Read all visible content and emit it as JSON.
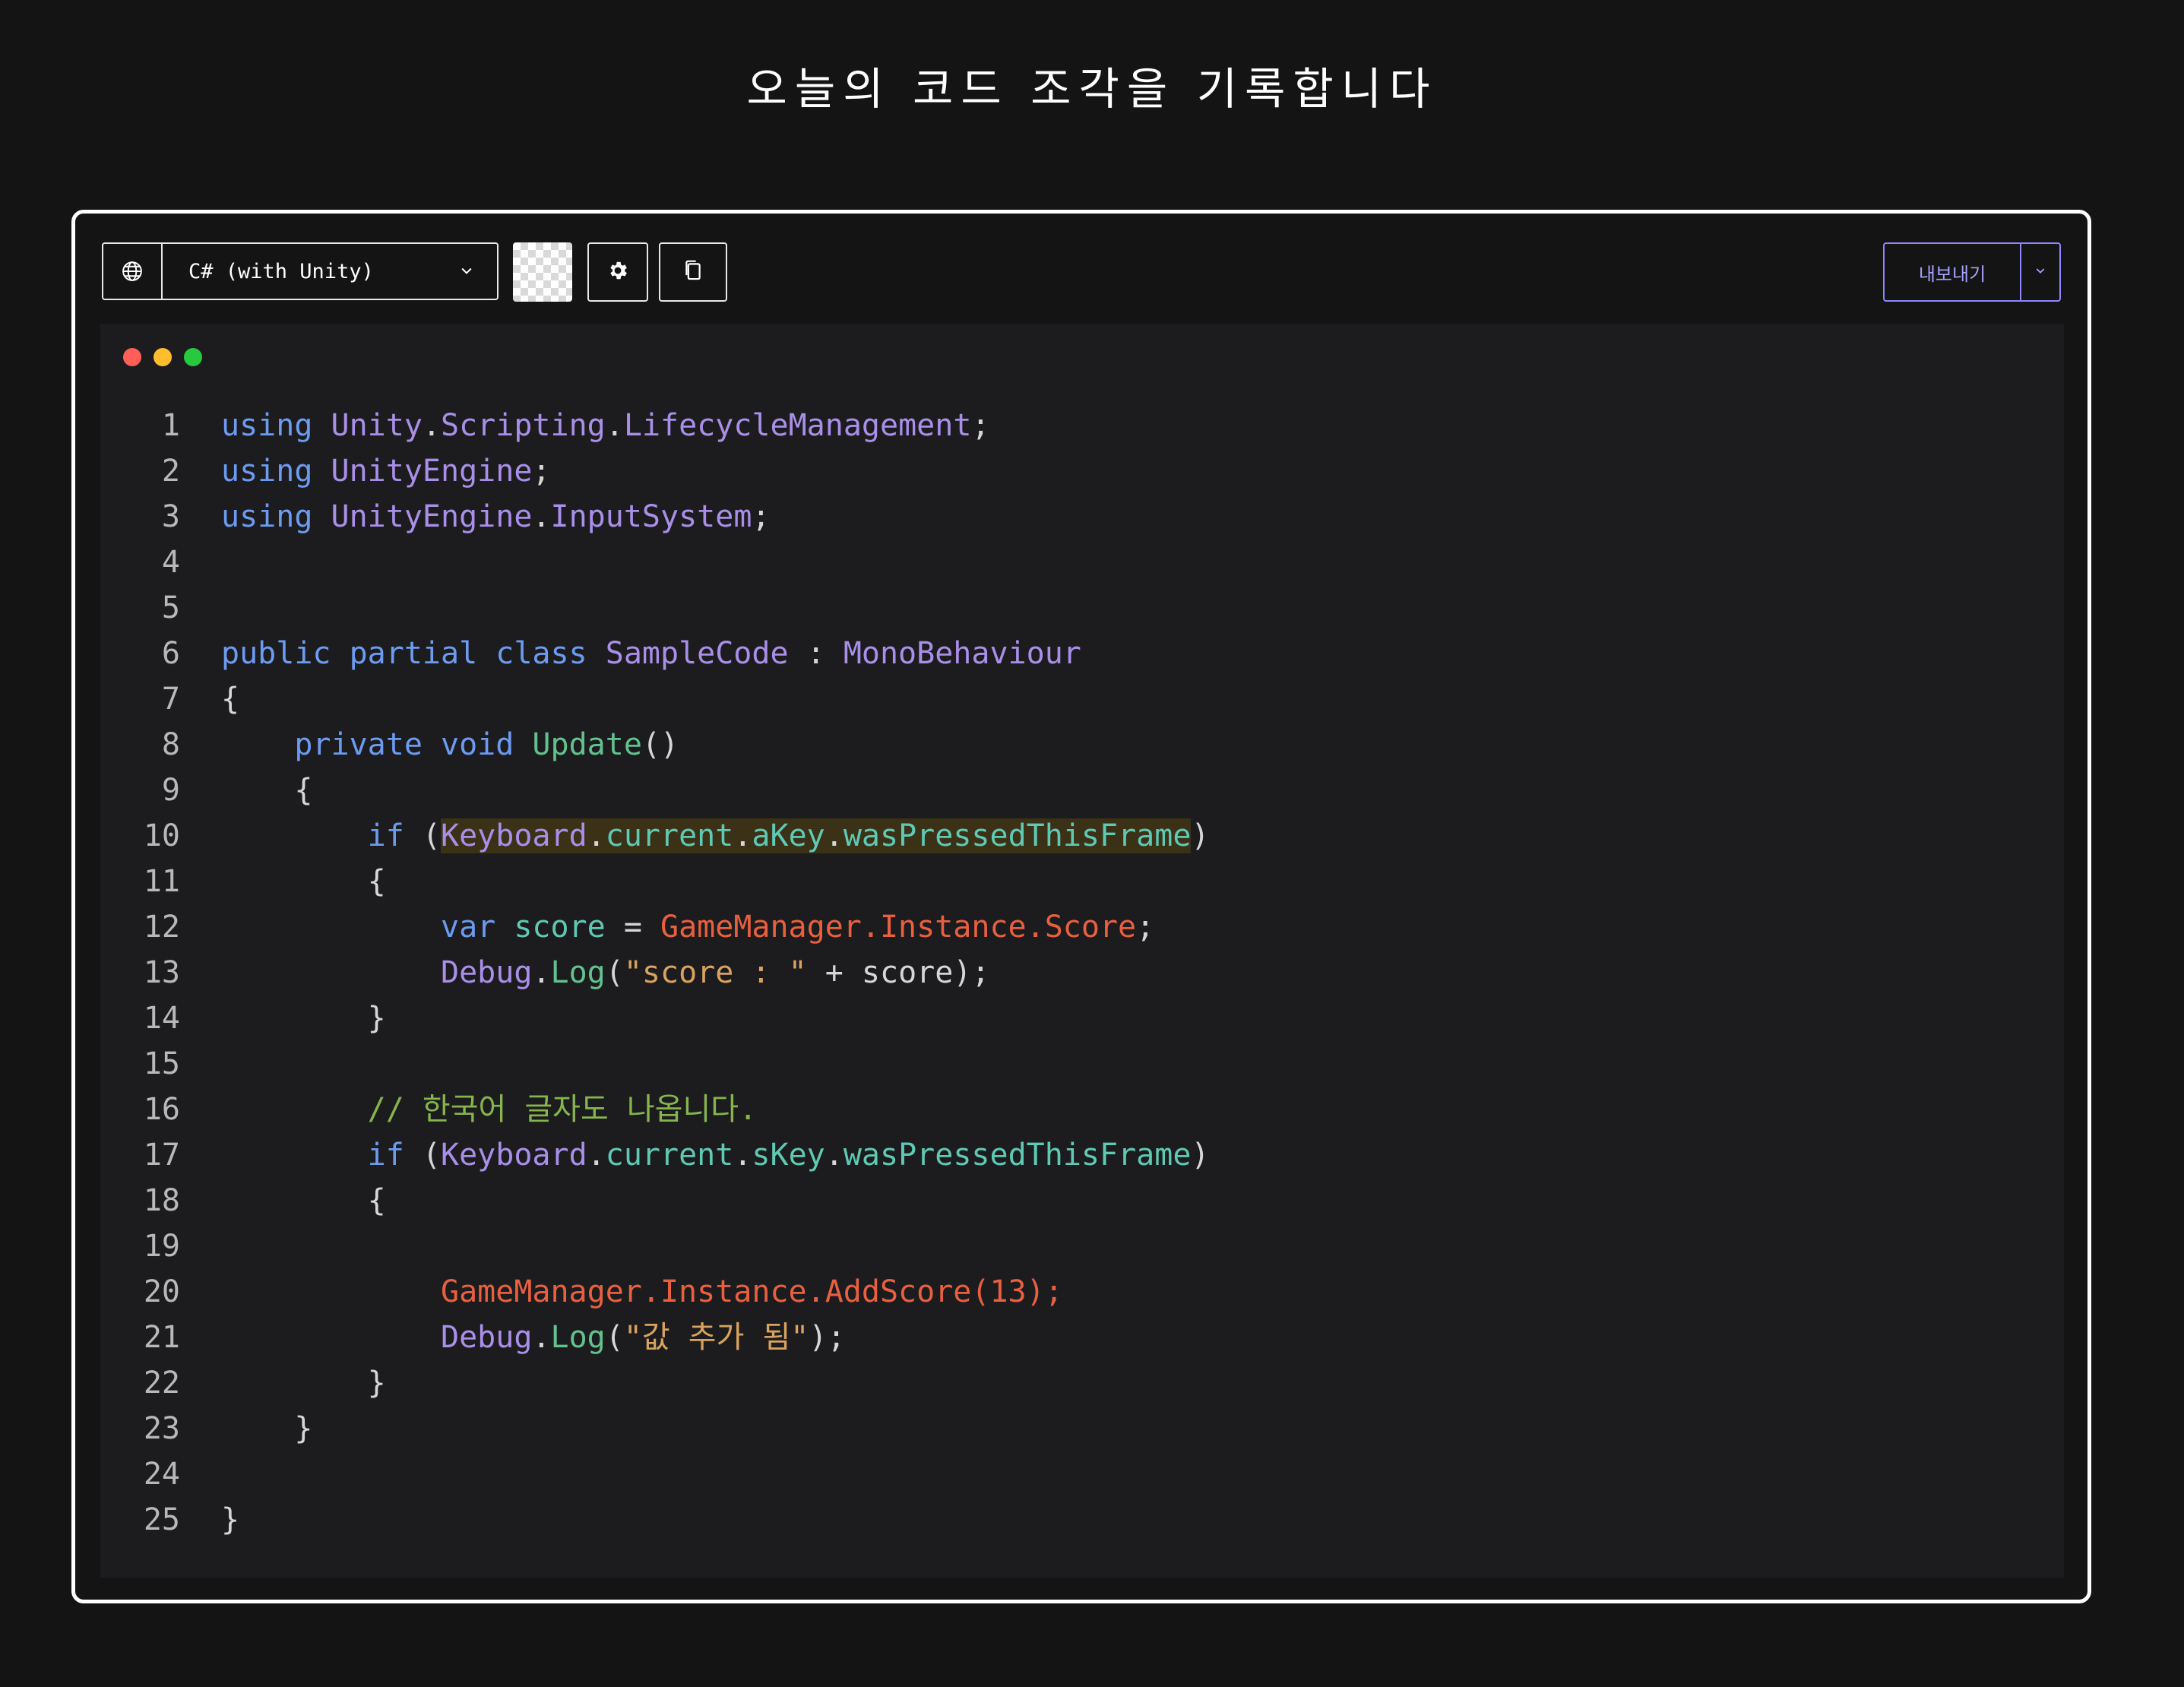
{
  "page": {
    "title": "오늘의 코드 조각을 기록합니다"
  },
  "toolbar": {
    "language": "C# (with Unity)",
    "export_label": "내보내기",
    "icons": [
      "globe-icon",
      "chevron-down-icon",
      "gear-icon",
      "copy-icon"
    ]
  },
  "window_dots": [
    "#ff5f56",
    "#ffbd2e",
    "#27c93f"
  ],
  "colors": {
    "keyword": "#6c9bf0",
    "type": "#a98fe8",
    "member": "#5fc9b4",
    "method": "#62c28f",
    "string": "#d9a35f",
    "gamemanager": "#e9603f",
    "comment": "#86b54d",
    "highlight": "#3a3117",
    "accent": "#8f86ff"
  },
  "code": {
    "lines": [
      {
        "n": "1",
        "tokens": [
          [
            "kw",
            "using "
          ],
          [
            "ty",
            "Unity"
          ],
          [
            "pn",
            "."
          ],
          [
            "ty",
            "Scripting"
          ],
          [
            "pn",
            "."
          ],
          [
            "ty",
            "LifecycleManagement"
          ],
          [
            "pn",
            ";"
          ]
        ]
      },
      {
        "n": "2",
        "tokens": [
          [
            "kw",
            "using "
          ],
          [
            "ty",
            "UnityEngine"
          ],
          [
            "pn",
            ";"
          ]
        ]
      },
      {
        "n": "3",
        "tokens": [
          [
            "kw",
            "using "
          ],
          [
            "ty",
            "UnityEngine"
          ],
          [
            "pn",
            "."
          ],
          [
            "ty",
            "InputSystem"
          ],
          [
            "pn",
            ";"
          ]
        ]
      },
      {
        "n": "4",
        "tokens": []
      },
      {
        "n": "5",
        "tokens": []
      },
      {
        "n": "6",
        "tokens": [
          [
            "kw",
            "public partial class "
          ],
          [
            "ty",
            "SampleCode"
          ],
          [
            "pn",
            " : "
          ],
          [
            "ty",
            "MonoBehaviour"
          ]
        ]
      },
      {
        "n": "7",
        "tokens": [
          [
            "pn",
            "{"
          ]
        ]
      },
      {
        "n": "8",
        "tokens": [
          [
            "pn",
            "    "
          ],
          [
            "kw",
            "private void "
          ],
          [
            "fn",
            "Update"
          ],
          [
            "pn",
            "()"
          ]
        ]
      },
      {
        "n": "9",
        "tokens": [
          [
            "pn",
            "    {"
          ]
        ]
      },
      {
        "n": "10",
        "tokens": [
          [
            "pn",
            "        "
          ],
          [
            "kw",
            "if "
          ],
          [
            "pn",
            "("
          ],
          [
            "ty hl",
            "Keyboard"
          ],
          [
            "pn hl",
            "."
          ],
          [
            "mb hl",
            "current"
          ],
          [
            "pn hl",
            "."
          ],
          [
            "mb hl",
            "aKey"
          ],
          [
            "pn hl",
            "."
          ],
          [
            "mb hl",
            "wasPressedThisFrame"
          ],
          [
            "pn",
            ")"
          ]
        ]
      },
      {
        "n": "11",
        "tokens": [
          [
            "pn",
            "        {"
          ]
        ]
      },
      {
        "n": "12",
        "tokens": [
          [
            "pn",
            "            "
          ],
          [
            "kw",
            "var "
          ],
          [
            "mb",
            "score"
          ],
          [
            "pn",
            " = "
          ],
          [
            "rd",
            "GameManager.Instance.Score"
          ],
          [
            "pn",
            ";"
          ]
        ]
      },
      {
        "n": "13",
        "tokens": [
          [
            "pn",
            "            "
          ],
          [
            "ty",
            "Debug"
          ],
          [
            "pn",
            "."
          ],
          [
            "fn",
            "Log"
          ],
          [
            "pn",
            "("
          ],
          [
            "st",
            "\"score : \""
          ],
          [
            "pn",
            " + score);"
          ]
        ]
      },
      {
        "n": "14",
        "tokens": [
          [
            "pn",
            "        }"
          ]
        ]
      },
      {
        "n": "15",
        "tokens": []
      },
      {
        "n": "16",
        "tokens": [
          [
            "pn",
            "        "
          ],
          [
            "cm",
            "// 한국어 글자도 나옵니다."
          ]
        ]
      },
      {
        "n": "17",
        "tokens": [
          [
            "pn",
            "        "
          ],
          [
            "kw",
            "if "
          ],
          [
            "pn",
            "("
          ],
          [
            "ty",
            "Keyboard"
          ],
          [
            "pn",
            "."
          ],
          [
            "mb",
            "current"
          ],
          [
            "pn",
            "."
          ],
          [
            "mb",
            "sKey"
          ],
          [
            "pn",
            "."
          ],
          [
            "mb",
            "wasPressedThisFrame"
          ],
          [
            "pn",
            ")"
          ]
        ]
      },
      {
        "n": "18",
        "tokens": [
          [
            "pn",
            "        {"
          ]
        ]
      },
      {
        "n": "19",
        "tokens": []
      },
      {
        "n": "20",
        "tokens": [
          [
            "pn",
            "            "
          ],
          [
            "rd",
            "GameManager.Instance.AddScore(13);"
          ]
        ]
      },
      {
        "n": "21",
        "tokens": [
          [
            "pn",
            "            "
          ],
          [
            "ty",
            "Debug"
          ],
          [
            "pn",
            "."
          ],
          [
            "fn",
            "Log"
          ],
          [
            "pn",
            "("
          ],
          [
            "st",
            "\"값 추가 됨\""
          ],
          [
            "pn",
            ");"
          ]
        ]
      },
      {
        "n": "22",
        "tokens": [
          [
            "pn",
            "        }"
          ]
        ]
      },
      {
        "n": "23",
        "tokens": [
          [
            "pn",
            "    }"
          ]
        ]
      },
      {
        "n": "24",
        "tokens": []
      },
      {
        "n": "25",
        "tokens": [
          [
            "pn",
            "}"
          ]
        ]
      }
    ]
  }
}
